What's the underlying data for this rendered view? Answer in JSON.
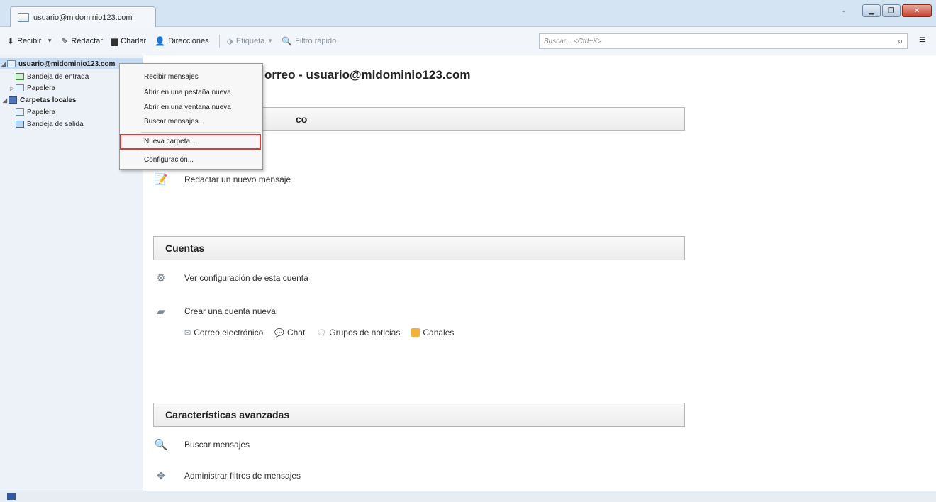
{
  "tab": {
    "title": "usuario@midominio123.com"
  },
  "window": {
    "minimize_glyph": "-"
  },
  "toolbar": {
    "items": [
      {
        "label": "Recibir",
        "icon": "download-icon",
        "has_dropdown": true
      },
      {
        "label": "Redactar",
        "icon": "pencil-icon"
      },
      {
        "label": "Charlar",
        "icon": "chat-icon"
      },
      {
        "label": "Direcciones",
        "icon": "addressbook-icon"
      },
      {
        "label": "Etiqueta",
        "icon": "tag-icon",
        "disabled": true,
        "has_dropdown": true
      },
      {
        "label": "Filtro rápido",
        "icon": "filter-icon",
        "disabled": true
      }
    ],
    "search_placeholder": "Buscar... <Ctrl+K>"
  },
  "sidebar": {
    "account": "usuario@midominio123.com",
    "items": [
      {
        "label": "Bandeja de entrada"
      },
      {
        "label": "Papelera"
      },
      {
        "label": "Carpetas locales"
      },
      {
        "label": "Papelera"
      },
      {
        "label": "Bandeja de salida"
      }
    ]
  },
  "main": {
    "heading": "orreo - usuario@midominio123.com",
    "section_email_partial": "co",
    "compose_label": "Redactar un nuevo mensaje",
    "section_accounts": "Cuentas",
    "view_settings": "Ver configuración de esta cuenta",
    "create_account": "Crear una cuenta nueva:",
    "account_types": [
      "Correo electrónico",
      "Chat",
      "Grupos de noticias",
      "Canales"
    ],
    "section_advanced": "Características avanzadas",
    "search_messages": "Buscar mensajes",
    "manage_filters": "Administrar filtros de mensajes"
  },
  "context_menu": {
    "items": [
      "Recibir mensajes",
      "Abrir en una pestaña nueva",
      "Abrir en una ventana nueva",
      "Buscar mensajes...",
      "Nueva carpeta...",
      "Configuración..."
    ],
    "highlighted_index": 4,
    "highlight_color": "#d93a3a"
  }
}
